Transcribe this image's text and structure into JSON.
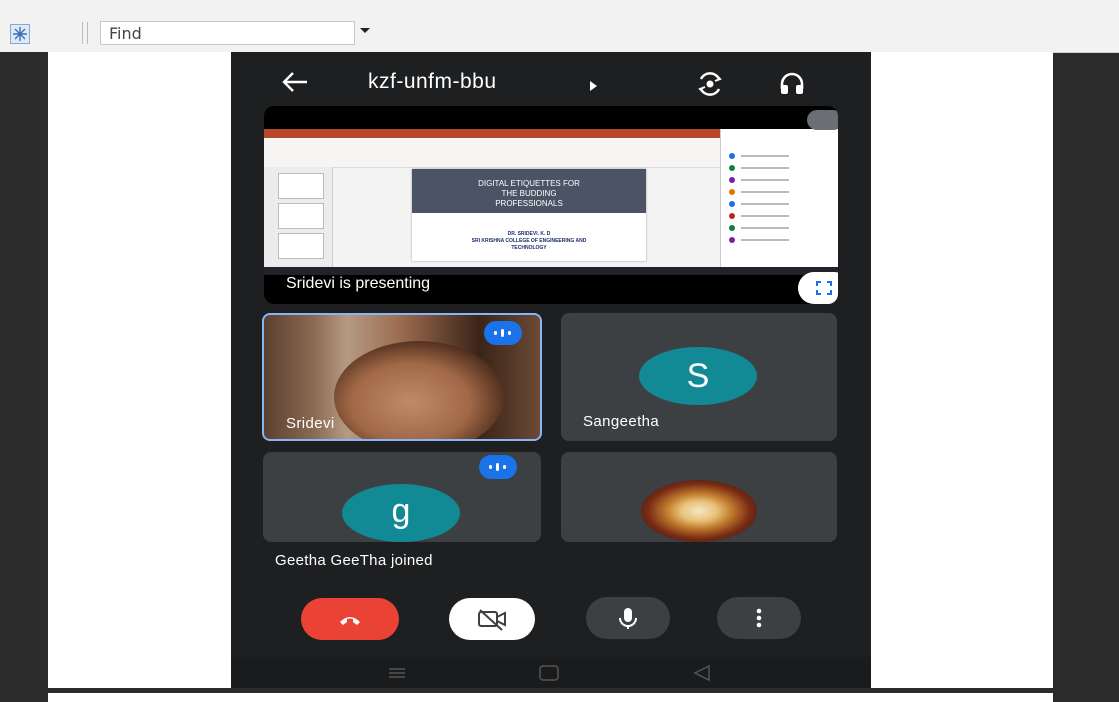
{
  "toolbar": {
    "find_placeholder": "Find",
    "icon": "snowflake-app-icon"
  },
  "meeting": {
    "code": "kzf-unfm-bbu",
    "icons": [
      "back-arrow-icon",
      "switch-camera-icon",
      "headphones-icon"
    ]
  },
  "presentation": {
    "label": "Sridevi is presenting",
    "slide_title_lines": [
      "DIGITAL ETIQUETTES FOR",
      "THE BUDDING",
      "PROFESSIONALS"
    ],
    "slide_author": "DR. SRIDEVI. K. D",
    "slide_institution_lines": [
      "SRI KRISHNA COLLEGE OF ENGINEERING AND",
      "TECHNOLOGY"
    ]
  },
  "participants": [
    {
      "name": "Sridevi",
      "type": "video",
      "speaking": true
    },
    {
      "name": "Sangeetha",
      "type": "avatar",
      "initial": "S"
    },
    {
      "name": "",
      "type": "avatar",
      "initial": "g",
      "speaking": true
    },
    {
      "name": "",
      "type": "image"
    }
  ],
  "notification": "Geetha GeeTha joined",
  "controls": [
    "end-call",
    "camera-off",
    "microphone",
    "more-options"
  ],
  "colors": {
    "end_call": "#ea4335",
    "speaking_badge": "#1a73e8",
    "avatar": "#128a95",
    "tile": "#3c4043",
    "active_border": "#8ab4f8"
  }
}
